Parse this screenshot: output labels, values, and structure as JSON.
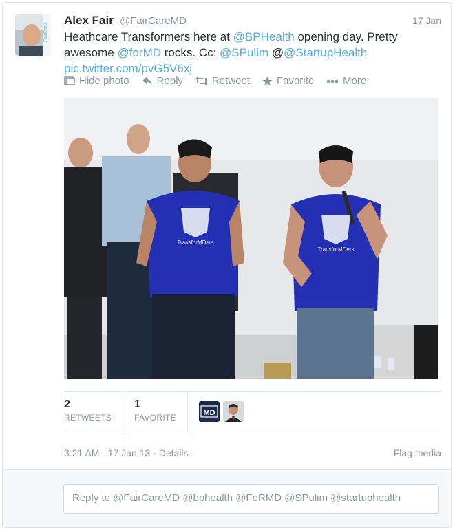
{
  "tweet": {
    "author_name": "Alex Fair",
    "author_handle": "@FairCareMD",
    "date": "17 Jan",
    "text_segments": [
      {
        "t": "Heathcare Transformers here at ",
        "link": false
      },
      {
        "t": "@BPHealth",
        "link": true
      },
      {
        "t": " opening day. Pretty awesome ",
        "link": false
      },
      {
        "t": "@forMD",
        "link": true
      },
      {
        "t": " rocks. Cc: ",
        "link": false
      },
      {
        "t": "@SPulim",
        "link": true
      },
      {
        "t": " @",
        "link": false
      },
      {
        "t": "@StartupHealth",
        "link": true
      },
      {
        "t": " ",
        "link": false
      },
      {
        "t": "pic.twitter.com/pvG5V6xj",
        "link": true
      }
    ]
  },
  "actions": {
    "hide_photo": "Hide photo",
    "reply": "Reply",
    "retweet": "Retweet",
    "favorite": "Favorite",
    "more": "More"
  },
  "photo": {
    "shirt_text": "TransforMDers"
  },
  "stats": {
    "retweets_count": "2",
    "retweets_label": "RETWEETS",
    "favorites_count": "1",
    "favorites_label": "FAVORITE"
  },
  "favoriters": {
    "md_logo_text": "MD"
  },
  "footer": {
    "timestamp": "3:21 AM - 17 Jan 13 · Details",
    "flag": "Flag media"
  },
  "reply": {
    "placeholder": "Reply to @FairCareMD @bphealth @FoRMD @SPulim @startuphealth"
  },
  "colors": {
    "link": "#55acee",
    "muted": "#8899a6",
    "text": "#292f33"
  }
}
